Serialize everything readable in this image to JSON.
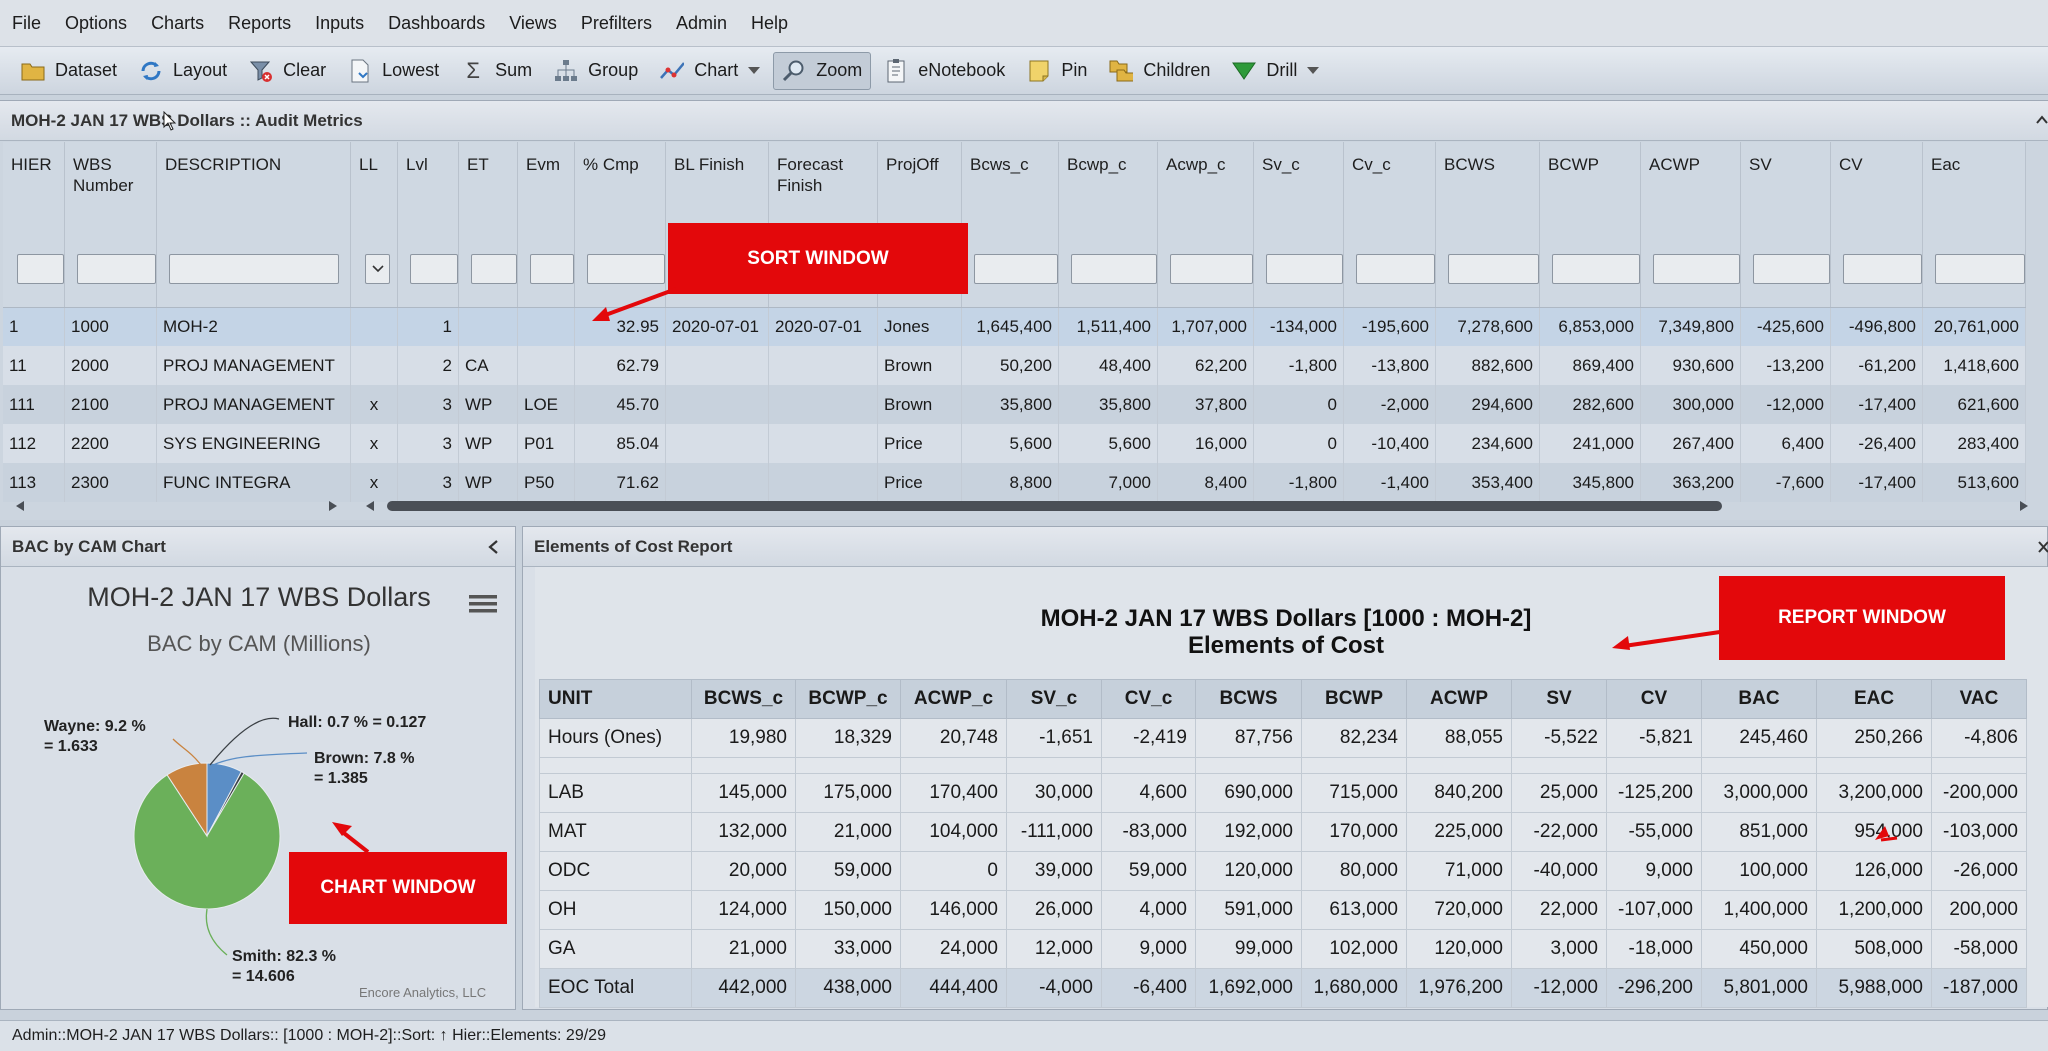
{
  "menu": [
    "File",
    "Options",
    "Charts",
    "Reports",
    "Inputs",
    "Dashboards",
    "Views",
    "Prefilters",
    "Admin",
    "Help"
  ],
  "toolbar": {
    "dataset": "Dataset",
    "layout": "Layout",
    "clear": "Clear",
    "lowest": "Lowest",
    "sum": "Sum",
    "group": "Group",
    "chart": "Chart",
    "zoom": "Zoom",
    "enotebook": "eNotebook",
    "pin": "Pin",
    "children": "Children",
    "drill": "Drill"
  },
  "grid": {
    "title": "MOH-2 JAN 17 WBS Dollars :: Audit Metrics",
    "columns": [
      "HIER",
      "WBS Number",
      "DESCRIPTION",
      "LL",
      "Lvl",
      "ET",
      "Evm",
      "% Cmp",
      "BL Finish",
      "Forecast Finish",
      "ProjOff",
      "Bcws_c",
      "Bcwp_c",
      "Acwp_c",
      "Sv_c",
      "Cv_c",
      "BCWS",
      "BCWP",
      "ACWP",
      "SV",
      "CV",
      "Eac"
    ],
    "rows": [
      [
        "1",
        "1000",
        "MOH-2",
        "",
        "1",
        "",
        "",
        "32.95",
        "2020-07-01",
        "2020-07-01",
        "Jones",
        "1,645,400",
        "1,511,400",
        "1,707,000",
        "-134,000",
        "-195,600",
        "7,278,600",
        "6,853,000",
        "7,349,800",
        "-425,600",
        "-496,800",
        "20,761,000"
      ],
      [
        "11",
        "2000",
        "PROJ MANAGEMENT",
        "",
        "2",
        "CA",
        "",
        "62.79",
        "",
        "",
        "Brown",
        "50,200",
        "48,400",
        "62,200",
        "-1,800",
        "-13,800",
        "882,600",
        "869,400",
        "930,600",
        "-13,200",
        "-61,200",
        "1,418,600"
      ],
      [
        "111",
        "2100",
        "PROJ MANAGEMENT",
        "x",
        "3",
        "WP",
        "LOE",
        "45.70",
        "",
        "",
        "Brown",
        "35,800",
        "35,800",
        "37,800",
        "0",
        "-2,000",
        "294,600",
        "282,600",
        "300,000",
        "-12,000",
        "-17,400",
        "621,600"
      ],
      [
        "112",
        "2200",
        "SYS ENGINEERING",
        "x",
        "3",
        "WP",
        "P01",
        "85.04",
        "",
        "",
        "Price",
        "5,600",
        "5,600",
        "16,000",
        "0",
        "-10,400",
        "234,600",
        "241,000",
        "267,400",
        "6,400",
        "-26,400",
        "283,400"
      ],
      [
        "113",
        "2300",
        "FUNC INTEGRA",
        "x",
        "3",
        "WP",
        "P50",
        "71.62",
        "",
        "",
        "Price",
        "8,800",
        "7,000",
        "8,400",
        "-1,800",
        "-1,400",
        "353,400",
        "345,800",
        "363,200",
        "-7,600",
        "-17,400",
        "513,600"
      ]
    ]
  },
  "callouts": {
    "sort": "SORT WINDOW",
    "chart": "CHART WINDOW",
    "report": "REPORT WINDOW"
  },
  "chart_panel": {
    "title": "BAC by CAM Chart",
    "chart_title": "MOH-2 JAN 17 WBS Dollars",
    "chart_subtitle": "BAC by CAM (Millions)",
    "credit": "Encore Analytics, LLC",
    "labels": {
      "wayne_1": "Wayne: 9.2 %",
      "wayne_2": "= 1.633",
      "hall": "Hall: 0.7 % = 0.127",
      "brown_1": "Brown: 7.8 %",
      "brown_2": "= 1.385",
      "smith_1": "Smith: 82.3 %",
      "smith_2": "= 14.606"
    }
  },
  "chart_data": {
    "type": "pie",
    "title": "MOH-2 JAN 17 WBS Dollars",
    "subtitle": "BAC by CAM (Millions)",
    "slices": [
      {
        "name": "Smith",
        "percent": 82.3,
        "value": 14.606,
        "color": "#6bb05a"
      },
      {
        "name": "Wayne",
        "percent": 9.2,
        "value": 1.633,
        "color": "#c9833f"
      },
      {
        "name": "Brown",
        "percent": 7.8,
        "value": 1.385,
        "color": "#5b8ec6"
      },
      {
        "name": "Hall",
        "percent": 0.7,
        "value": 0.127,
        "color": "#3a3f44"
      }
    ]
  },
  "report_panel": {
    "title": "Elements of Cost Report",
    "heading_1": "MOH-2 JAN 17 WBS Dollars [1000 : MOH-2]",
    "heading_2": "Elements of Cost",
    "columns": [
      "UNIT",
      "BCWS_c",
      "BCWP_c",
      "ACWP_c",
      "SV_c",
      "CV_c",
      "BCWS",
      "BCWP",
      "ACWP",
      "SV",
      "CV",
      "BAC",
      "EAC",
      "VAC"
    ],
    "rows": [
      [
        "Hours (Ones)",
        "19,980",
        "18,329",
        "20,748",
        "-1,651",
        "-2,419",
        "87,756",
        "82,234",
        "88,055",
        "-5,522",
        "-5,821",
        "245,460",
        "250,266",
        "-4,806"
      ],
      [
        "LAB",
        "145,000",
        "175,000",
        "170,400",
        "30,000",
        "4,600",
        "690,000",
        "715,000",
        "840,200",
        "25,000",
        "-125,200",
        "3,000,000",
        "3,200,000",
        "-200,000"
      ],
      [
        "MAT",
        "132,000",
        "21,000",
        "104,000",
        "-111,000",
        "-83,000",
        "192,000",
        "170,000",
        "225,000",
        "-22,000",
        "-55,000",
        "851,000",
        "954,000",
        "-103,000"
      ],
      [
        "ODC",
        "20,000",
        "59,000",
        "0",
        "39,000",
        "59,000",
        "120,000",
        "80,000",
        "71,000",
        "-40,000",
        "9,000",
        "100,000",
        "126,000",
        "-26,000"
      ],
      [
        "OH",
        "124,000",
        "150,000",
        "146,000",
        "26,000",
        "4,000",
        "591,000",
        "613,000",
        "720,000",
        "22,000",
        "-107,000",
        "1,400,000",
        "1,200,000",
        "200,000"
      ],
      [
        "GA",
        "21,000",
        "33,000",
        "24,000",
        "12,000",
        "9,000",
        "99,000",
        "102,000",
        "120,000",
        "3,000",
        "-18,000",
        "450,000",
        "508,000",
        "-58,000"
      ]
    ],
    "total": [
      "EOC Total",
      "442,000",
      "438,000",
      "444,400",
      "-4,000",
      "-6,400",
      "1,692,000",
      "1,680,000",
      "1,976,200",
      "-12,000",
      "-296,200",
      "5,801,000",
      "5,988,000",
      "-187,000"
    ]
  },
  "status": "Admin::MOH-2 JAN 17 WBS Dollars:: [1000 : MOH-2]::Sort: ↑ Hier::Elements: 29/29"
}
